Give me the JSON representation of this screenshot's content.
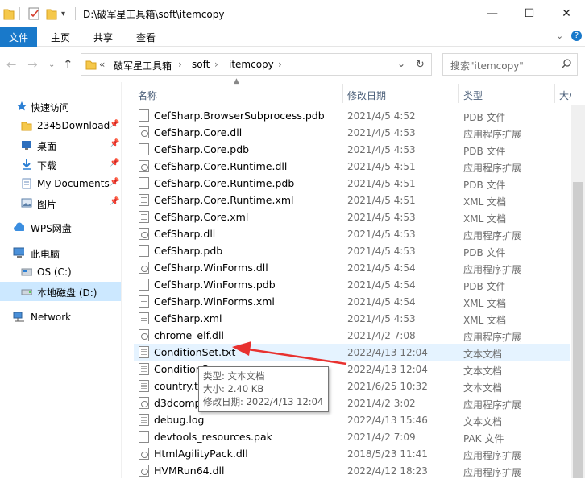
{
  "window": {
    "title": "D:\\破军星工具箱\\soft\\itemcopy",
    "minimize_glyph": "—",
    "maximize_glyph": "☐",
    "close_glyph": "✕"
  },
  "ribbon": {
    "tabs": [
      "文件",
      "主页",
      "共享",
      "查看"
    ],
    "collapse_glyph": "⌄",
    "help_glyph": "?"
  },
  "address": {
    "chevron": "«",
    "crumbs": [
      "破军星工具箱",
      "soft",
      "itemcopy"
    ],
    "separator": "›",
    "dropdown_glyph": "⌄",
    "refresh_glyph": "↻"
  },
  "search": {
    "placeholder": "搜索\"itemcopy\""
  },
  "sidebar": {
    "items": [
      {
        "label": "快速访问",
        "icon": "star-icon",
        "pinned": false
      },
      {
        "label": "2345Download",
        "icon": "folder-icon",
        "pinned": true
      },
      {
        "label": "桌面",
        "icon": "desktop-icon",
        "pinned": true
      },
      {
        "label": "下载",
        "icon": "download-icon",
        "pinned": true
      },
      {
        "label": "My Documents",
        "icon": "documents-icon",
        "pinned": true
      },
      {
        "label": "图片",
        "icon": "pictures-icon",
        "pinned": true
      },
      {
        "label": "WPS网盘",
        "icon": "cloud-icon",
        "pinned": false
      },
      {
        "label": "此电脑",
        "icon": "computer-icon",
        "pinned": false
      },
      {
        "label": "OS (C:)",
        "icon": "drive-icon",
        "pinned": false
      },
      {
        "label": "本地磁盘 (D:)",
        "icon": "drive-icon",
        "pinned": false,
        "selected": true
      },
      {
        "label": "Network",
        "icon": "network-icon",
        "pinned": false
      }
    ]
  },
  "columns": {
    "name": "名称",
    "date": "修改日期",
    "type": "类型",
    "size": "大小"
  },
  "files": [
    {
      "name": "CefSharp.BrowserSubprocess.pdb",
      "date": "2021/4/5 4:52",
      "type": "PDB 文件",
      "icon": "file-icon"
    },
    {
      "name": "CefSharp.Core.dll",
      "date": "2021/4/5 4:53",
      "type": "应用程序扩展",
      "icon": "dll-icon"
    },
    {
      "name": "CefSharp.Core.pdb",
      "date": "2021/4/5 4:53",
      "type": "PDB 文件",
      "icon": "file-icon"
    },
    {
      "name": "CefSharp.Core.Runtime.dll",
      "date": "2021/4/5 4:51",
      "type": "应用程序扩展",
      "icon": "dll-icon"
    },
    {
      "name": "CefSharp.Core.Runtime.pdb",
      "date": "2021/4/5 4:51",
      "type": "PDB 文件",
      "icon": "file-icon"
    },
    {
      "name": "CefSharp.Core.Runtime.xml",
      "date": "2021/4/5 4:51",
      "type": "XML 文档",
      "icon": "xml-icon"
    },
    {
      "name": "CefSharp.Core.xml",
      "date": "2021/4/5 4:53",
      "type": "XML 文档",
      "icon": "xml-icon"
    },
    {
      "name": "CefSharp.dll",
      "date": "2021/4/5 4:53",
      "type": "应用程序扩展",
      "icon": "dll-icon"
    },
    {
      "name": "CefSharp.pdb",
      "date": "2021/4/5 4:53",
      "type": "PDB 文件",
      "icon": "file-icon"
    },
    {
      "name": "CefSharp.WinForms.dll",
      "date": "2021/4/5 4:54",
      "type": "应用程序扩展",
      "icon": "dll-icon"
    },
    {
      "name": "CefSharp.WinForms.pdb",
      "date": "2021/4/5 4:54",
      "type": "PDB 文件",
      "icon": "file-icon"
    },
    {
      "name": "CefSharp.WinForms.xml",
      "date": "2021/4/5 4:54",
      "type": "XML 文档",
      "icon": "xml-icon"
    },
    {
      "name": "CefSharp.xml",
      "date": "2021/4/5 4:53",
      "type": "XML 文档",
      "icon": "xml-icon"
    },
    {
      "name": "chrome_elf.dll",
      "date": "2021/4/2 7:08",
      "type": "应用程序扩展",
      "icon": "dll-icon"
    },
    {
      "name": "ConditionSet.txt",
      "date": "2022/4/13 12:04",
      "type": "文本文档",
      "icon": "txt-icon",
      "hover": true
    },
    {
      "name": "ConditionS",
      "date": "2022/4/13 12:04",
      "type": "文本文档",
      "icon": "txt-icon"
    },
    {
      "name": "country.tx",
      "date": "2021/6/25 10:32",
      "type": "文本文档",
      "icon": "txt-icon"
    },
    {
      "name": "d3dcomp",
      "date": "2021/4/2 3:02",
      "type": "应用程序扩展",
      "icon": "dll-icon"
    },
    {
      "name": "debug.log",
      "date": "2022/4/13 15:46",
      "type": "文本文档",
      "icon": "txt-icon"
    },
    {
      "name": "devtools_resources.pak",
      "date": "2021/4/2 7:09",
      "type": "PAK 文件",
      "icon": "file-icon"
    },
    {
      "name": "HtmlAgilityPack.dll",
      "date": "2018/5/23 11:41",
      "type": "应用程序扩展",
      "icon": "dll-icon"
    },
    {
      "name": "HVMRun64.dll",
      "date": "2022/4/12 18:23",
      "type": "应用程序扩展",
      "icon": "dll-icon"
    }
  ],
  "tooltip": {
    "type_line": "类型: 文本文档",
    "size_line": "大小: 2.40 KB",
    "date_line": "修改日期: 2022/4/13 12:04"
  },
  "colors": {
    "accent": "#1979ca",
    "selection": "#cce8ff",
    "hover": "#e5f3ff",
    "arrow": "#e8312f"
  }
}
